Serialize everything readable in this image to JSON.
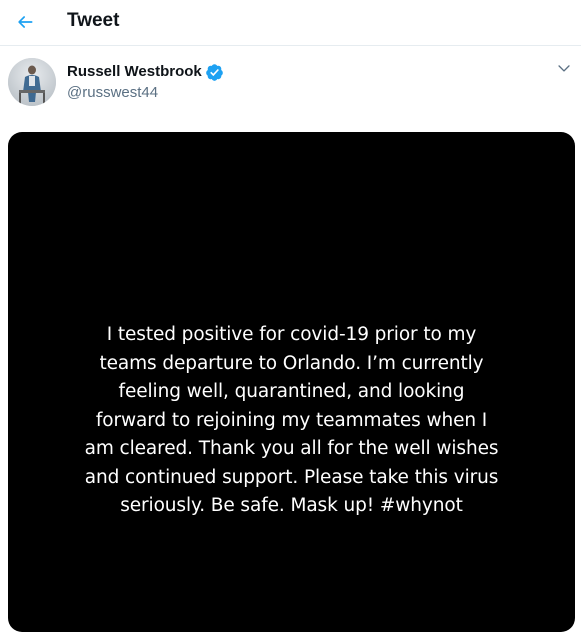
{
  "header": {
    "title": "Tweet",
    "back_icon": "arrow-left-icon",
    "accent_color": "#1da1f2"
  },
  "author": {
    "display_name": "Russell Westbrook",
    "handle": "@russwest44",
    "verified": true,
    "verified_icon": "verified-badge-icon",
    "verified_color": "#1da1f2"
  },
  "more_icon": "chevron-down-icon",
  "media": {
    "background_color": "#000000",
    "text_color": "#ffffff",
    "lines": [
      "I tested positive for covid-19 prior to my",
      "teams departure to Orlando. I’m currently",
      "feeling well, quarantined, and looking",
      "forward to rejoining my teammates when I",
      "am cleared. Thank you all for the well wishes",
      "and continued support. Please take this virus",
      "seriously. Be safe. Mask up! #whynot"
    ]
  }
}
